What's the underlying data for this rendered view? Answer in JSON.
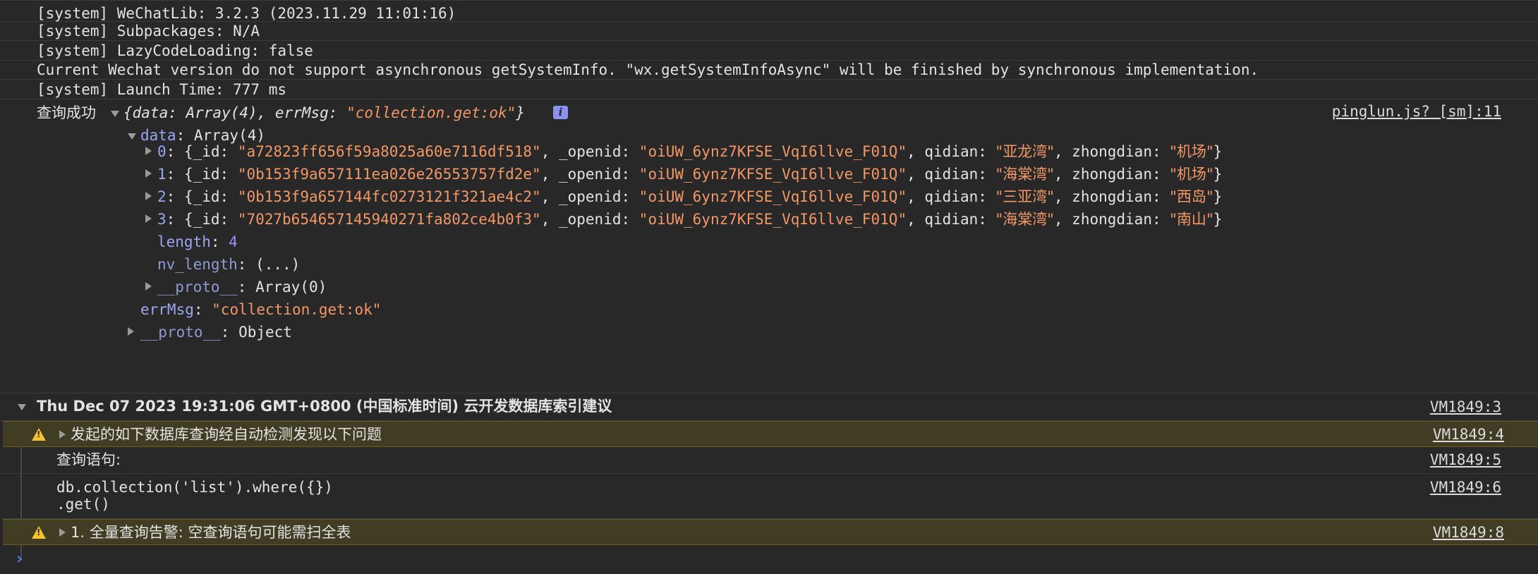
{
  "system_lines": [
    "[system] WeChatLib: 3.2.3 (2023.11.29 11:01:16)",
    "[system] Subpackages: N/A",
    "[system] LazyCodeLoading: false",
    "Current Wechat version do not support asynchronous getSystemInfo. \"wx.getSystemInfoAsync\" will be finished by synchronous implementation.",
    "[system] Launch Time: 777 ms"
  ],
  "query_log": {
    "label": "查询成功",
    "summary_prefix": "{data: Array(4), errMsg: ",
    "summary_value": "\"collection.get:ok\"",
    "summary_suffix": "}",
    "info_badge": "i",
    "source": "pinglun.js? [sm]:11",
    "data_key": "data",
    "data_type": ": Array(4)",
    "items": [
      {
        "index": "0",
        "_id": "a72823ff656f59a8025a60e7116df518",
        "_openid": "oiUW_6ynz7KFSE_VqI6llve_F01Q",
        "qidian": "亚龙湾",
        "zhongdian": "机场"
      },
      {
        "index": "1",
        "_id": "0b153f9a657111ea026e26553757fd2e",
        "_openid": "oiUW_6ynz7KFSE_VqI6llve_F01Q",
        "qidian": "海棠湾",
        "zhongdian": "机场"
      },
      {
        "index": "2",
        "_id": "0b153f9a657144fc0273121f321ae4c2",
        "_openid": "oiUW_6ynz7KFSE_VqI6llve_F01Q",
        "qidian": "三亚湾",
        "zhongdian": "西岛"
      },
      {
        "index": "3",
        "_id": "7027b654657145940271fa802ce4b0f3",
        "_openid": "oiUW_6ynz7KFSE_VqI6llve_F01Q",
        "qidian": "海棠湾",
        "zhongdian": "南山"
      }
    ],
    "length_key": "length",
    "length_value": "4",
    "nv_length_key": "nv_length",
    "nv_length_value": ": (...)",
    "array_proto_key": "__proto__",
    "array_proto_value": ": Array(0)",
    "errmsg_key": "errMsg",
    "errmsg_value": "\"collection.get:ok\"",
    "obj_proto_key": "__proto__",
    "obj_proto_value": ": Object"
  },
  "group": {
    "title": "Thu Dec 07 2023 19:31:06 GMT+0800 (中国标准时间) 云开发数据库索引建议",
    "source": "VM1849:3",
    "warning1": "发起的如下数据库查询经自动检测发现以下问题",
    "warning1_source": "VM1849:4",
    "query_label": "查询语句:",
    "query_label_source": "VM1849:5",
    "query_code_line1": "db.collection('list').where({})",
    "query_code_line2": ".get()",
    "query_code_source": "VM1849:6",
    "warning2": "1. 全量查询告警: 空查询语句可能需扫全表",
    "warning2_source": "VM1849:8"
  },
  "prompt_symbol": "›",
  "colors": {
    "background": "#282828",
    "string": "#f29766",
    "number": "#a38df5",
    "key": "#9aa7f0",
    "warning_bg": "#413c24",
    "warning_icon": "#f3c330",
    "prompt": "#5b8bff"
  }
}
